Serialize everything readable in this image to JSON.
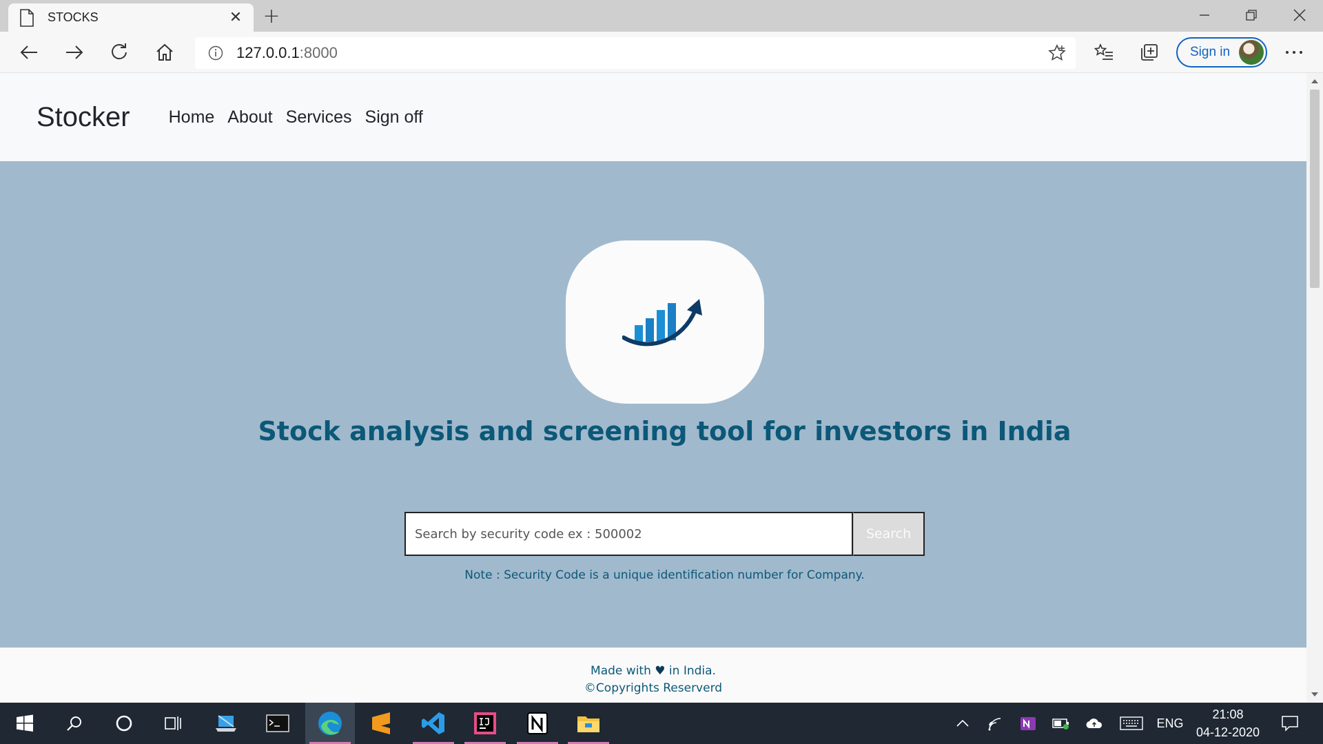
{
  "browser": {
    "tab_title": "STOCKS",
    "new_tab_symbol": "+",
    "close_symbol": "✕",
    "address_host": "127.0.0.1",
    "address_port": ":8000",
    "sign_in_label": "Sign in",
    "accent": "#0e63c2"
  },
  "site": {
    "brand": "Stocker",
    "nav": [
      "Home",
      "About",
      "Services",
      "Sign off"
    ],
    "headline": "Stock analysis and screening tool for investors in India",
    "search": {
      "value": "",
      "placeholder": "Search by security code ex : 500002",
      "button_label": "Search"
    },
    "note": "Note : Security Code is a unique identification number for Company.",
    "footer": {
      "made_prefix": "Made with",
      "heart": "♥",
      "made_suffix": "in India.",
      "copyright": "©Copyrights Reserverd"
    },
    "colors": {
      "hero_bg": "#a1b9cc",
      "text_accent": "#0b5878",
      "logo_blue": "#1b8fd6"
    }
  },
  "taskbar": {
    "apps": [
      "start-icon",
      "search-icon",
      "cortana-icon",
      "task-view-icon",
      "laptop-icon",
      "terminal-icon",
      "edge-icon",
      "sublime-text-icon",
      "vscode-icon",
      "intellij-icon",
      "notion-icon",
      "file-explorer-icon"
    ],
    "language": "ENG",
    "time": "21:08",
    "date": "04-12-2020"
  }
}
